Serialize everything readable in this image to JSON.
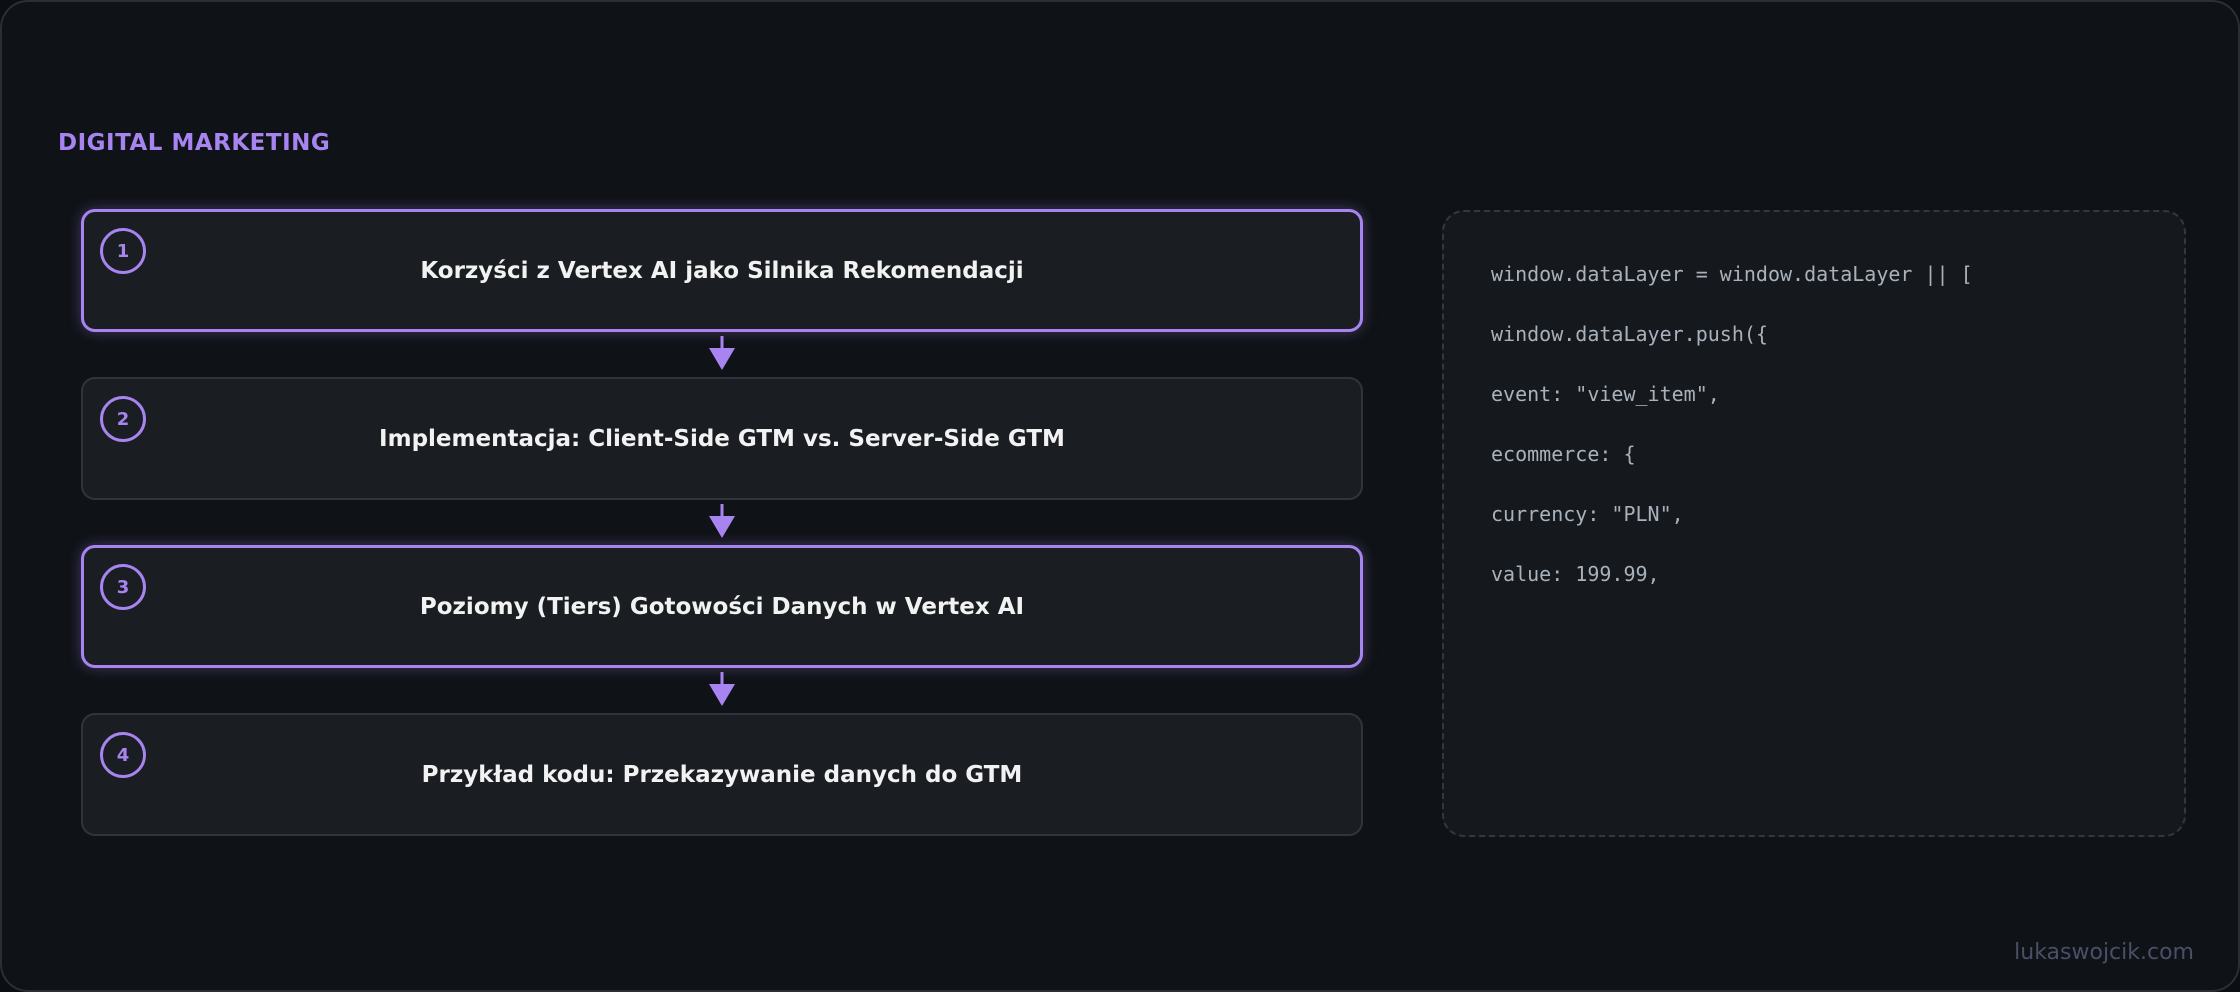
{
  "category": "DIGITAL MARKETING",
  "steps": [
    {
      "number": "1",
      "title": "Korzyści z Vertex AI jako Silnika Rekomendacji",
      "highlighted": true
    },
    {
      "number": "2",
      "title": "Implementacja: Client-Side GTM vs. Server-Side GTM",
      "highlighted": false
    },
    {
      "number": "3",
      "title": "Poziomy (Tiers) Gotowości Danych w Vertex AI",
      "highlighted": true
    },
    {
      "number": "4",
      "title": "Przykład kodu: Przekazywanie danych do GTM",
      "highlighted": false
    }
  ],
  "code_lines": [
    "window.dataLayer = window.dataLayer || [",
    "window.dataLayer.push({",
    "event: \"view_item\",",
    "ecommerce: {",
    "currency: \"PLN\",",
    "value: 199.99,"
  ],
  "watermark": "lukaswojcik.com",
  "colors": {
    "accent": "#a784f0",
    "background": "#0f1216",
    "card": "#1a1d22",
    "text": "#f2f2f2",
    "code_text": "#a9b2bc"
  },
  "icons": {
    "connector": "arrow-down-icon"
  }
}
